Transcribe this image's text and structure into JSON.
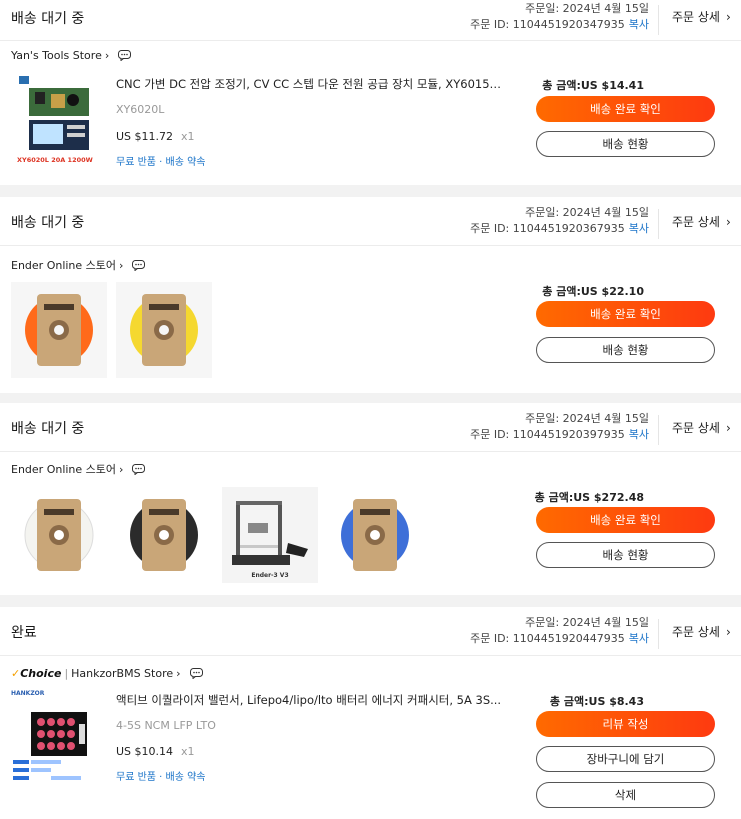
{
  "orders": [
    {
      "status": "배송 대기 중",
      "order_date": "주문일: 2024년 4월 15일",
      "order_id": "주문 ID: 1104451920347935",
      "copy": "복사",
      "detail": "주문 상세",
      "store": "Yan's Tools Store",
      "product_title": "CNC 가변 DC 전압 조정기, CV CC 스텝 다운 전원 공급 장치 모듈, XY6015L, ...",
      "sku": "XY6020L",
      "price": "US $11.72",
      "qty": "x1",
      "promise": "무료 반품 · 배송 약속",
      "thumb_caption": "XY6020L 20A 1200W",
      "total": "총 금액:US $14.41",
      "btn_primary": "배송 완료 확인",
      "btn_secondary": "배송 현황"
    },
    {
      "status": "배송 대기 중",
      "order_date": "주문일: 2024년 4월 15일",
      "order_id": "주문 ID: 1104451920367935",
      "copy": "복사",
      "detail": "주문 상세",
      "store": "Ender Online 스토어",
      "total": "총 금액:US $22.10",
      "btn_primary": "배송 완료 확인",
      "btn_secondary": "배송 현황"
    },
    {
      "status": "배송 대기 중",
      "order_date": "주문일: 2024년 4월 15일",
      "order_id": "주문 ID: 1104451920397935",
      "copy": "복사",
      "detail": "주문 상세",
      "store": "Ender Online 스토어",
      "printer_caption": "Ender-3 V3",
      "total": "총 금액:US $272.48",
      "btn_primary": "배송 완료 확인",
      "btn_secondary": "배송 현황"
    },
    {
      "status": "완료",
      "order_date": "주문일: 2024년 4월 15일",
      "order_id": "주문 ID: 1104451920447935",
      "copy": "복사",
      "detail": "주문 상세",
      "choice": "Choice",
      "store": "HankzorBMS Store",
      "product_title": "액티브 이퀄라이저 밸런서, Lifepo4/lipo/lto 배터리 에너지 커패시터, 5A 3S...",
      "sku": "4-5S NCM LFP LTO",
      "price": "US $10.14",
      "qty": "x1",
      "promise": "무료 반품 · 배송 약속",
      "thumb_brand": "HANKZOR",
      "total": "총 금액:US $8.43",
      "btn_primary": "리뷰 작성",
      "btn_secondary": "장바구니에 담기",
      "btn_tertiary": "삭제"
    }
  ],
  "colors": {
    "accent": "#ff5a0a",
    "link": "#1a73c8",
    "filament_colors": [
      "#ff6a1a",
      "#f5d830",
      "#f4f4f0",
      "#2b2b2b",
      "#3e6fd8"
    ]
  }
}
